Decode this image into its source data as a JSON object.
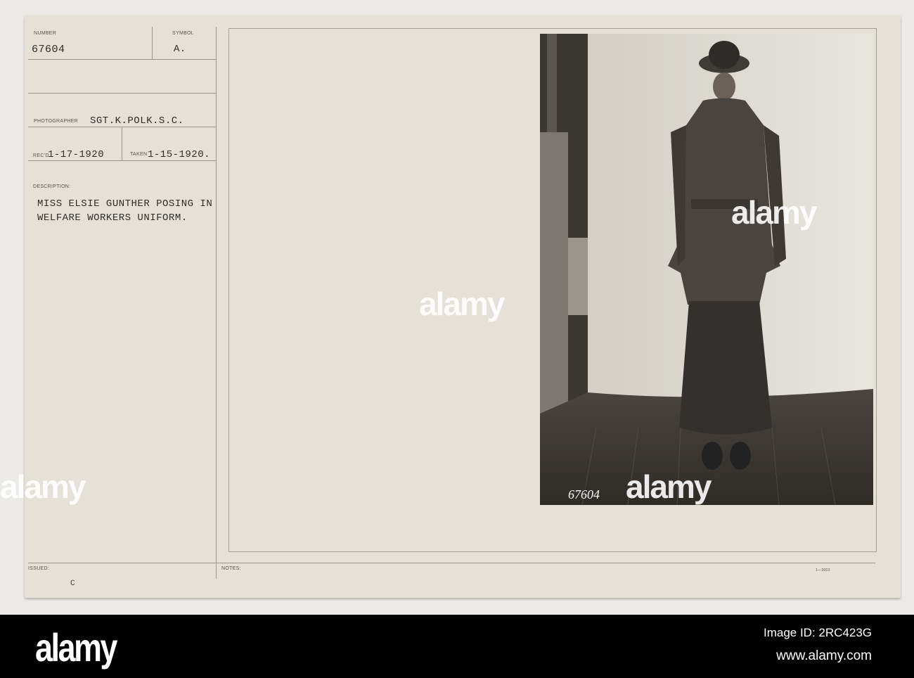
{
  "card": {
    "number_label": "NUMBER",
    "number": "67604",
    "symbol_label": "SYMBOL",
    "symbol": "A.",
    "photographer_label": "PHOTOGRAPHER",
    "photographer": "SGT.K.POLK.S.C.",
    "received_label": "REC'D",
    "received": "1-17-1920",
    "taken_label": "TAKEN",
    "taken": "1-15-1920.",
    "description_label": "DESCRIPTION:",
    "description_line1": "MISS ELSIE GUNTHER POSING IN",
    "description_line2": "WELFARE WORKERS UNIFORM.",
    "issued_label": "ISSUED:",
    "issued_mark": "C",
    "notes_label": "NOTES:",
    "form_code": "1—3003"
  },
  "photo": {
    "negative_number": "67604",
    "watermark": "alamy"
  },
  "footer": {
    "logo": "alamy",
    "image_id": "Image ID: 2RC423G",
    "url": "www.alamy.com"
  }
}
